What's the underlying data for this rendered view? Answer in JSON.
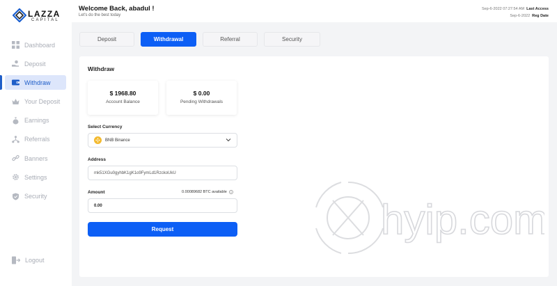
{
  "brand": {
    "name": "LAZZA",
    "sub": "CAPITAL"
  },
  "header": {
    "welcome": "Welcome Back, abadul !",
    "tagline": "Let's do the best today",
    "last_access_date": "Sep-6-2022 07:27:54 AM",
    "last_access_label": "Last Access",
    "reg_date": "Sep-6-2022",
    "reg_label": "Reg Date"
  },
  "sidebar": {
    "items": [
      {
        "label": "Dashboard",
        "icon": "grid-icon"
      },
      {
        "label": "Deposit",
        "icon": "hand-coin-icon"
      },
      {
        "label": "Withdraw",
        "icon": "wallet-icon"
      },
      {
        "label": "Your Deposit",
        "icon": "crown-icon"
      },
      {
        "label": "Earnings",
        "icon": "money-bag-icon"
      },
      {
        "label": "Referrals",
        "icon": "network-icon"
      },
      {
        "label": "Banners",
        "icon": "link-icon"
      },
      {
        "label": "Settings",
        "icon": "gear-icon"
      },
      {
        "label": "Security",
        "icon": "shield-icon"
      }
    ],
    "logout": "Logout"
  },
  "tabs": [
    "Deposit",
    "Withdrawal",
    "Referral",
    "Security"
  ],
  "withdraw": {
    "title": "Withdraw",
    "balance_value": "$ 1968.80",
    "balance_label": "Account Balance",
    "pending_value": "$ 0.00",
    "pending_label": "Pending Withdrawals",
    "currency_label": "Select Currency",
    "currency_value": "BNB Binance",
    "address_label": "Address",
    "address_value": "mk51XGu0gyhbK1gK1o9FymLd1RzckoUkU",
    "amount_label": "Amount",
    "available": "0.00089682 BTC available",
    "amount_value": "0.00",
    "request_button": "Request"
  },
  "watermark": {
    "text": "hyip.com"
  },
  "colors": {
    "accent": "#0d5ff5",
    "active_nav": "#1f5ec8",
    "bnb": "#f3ba2f"
  }
}
